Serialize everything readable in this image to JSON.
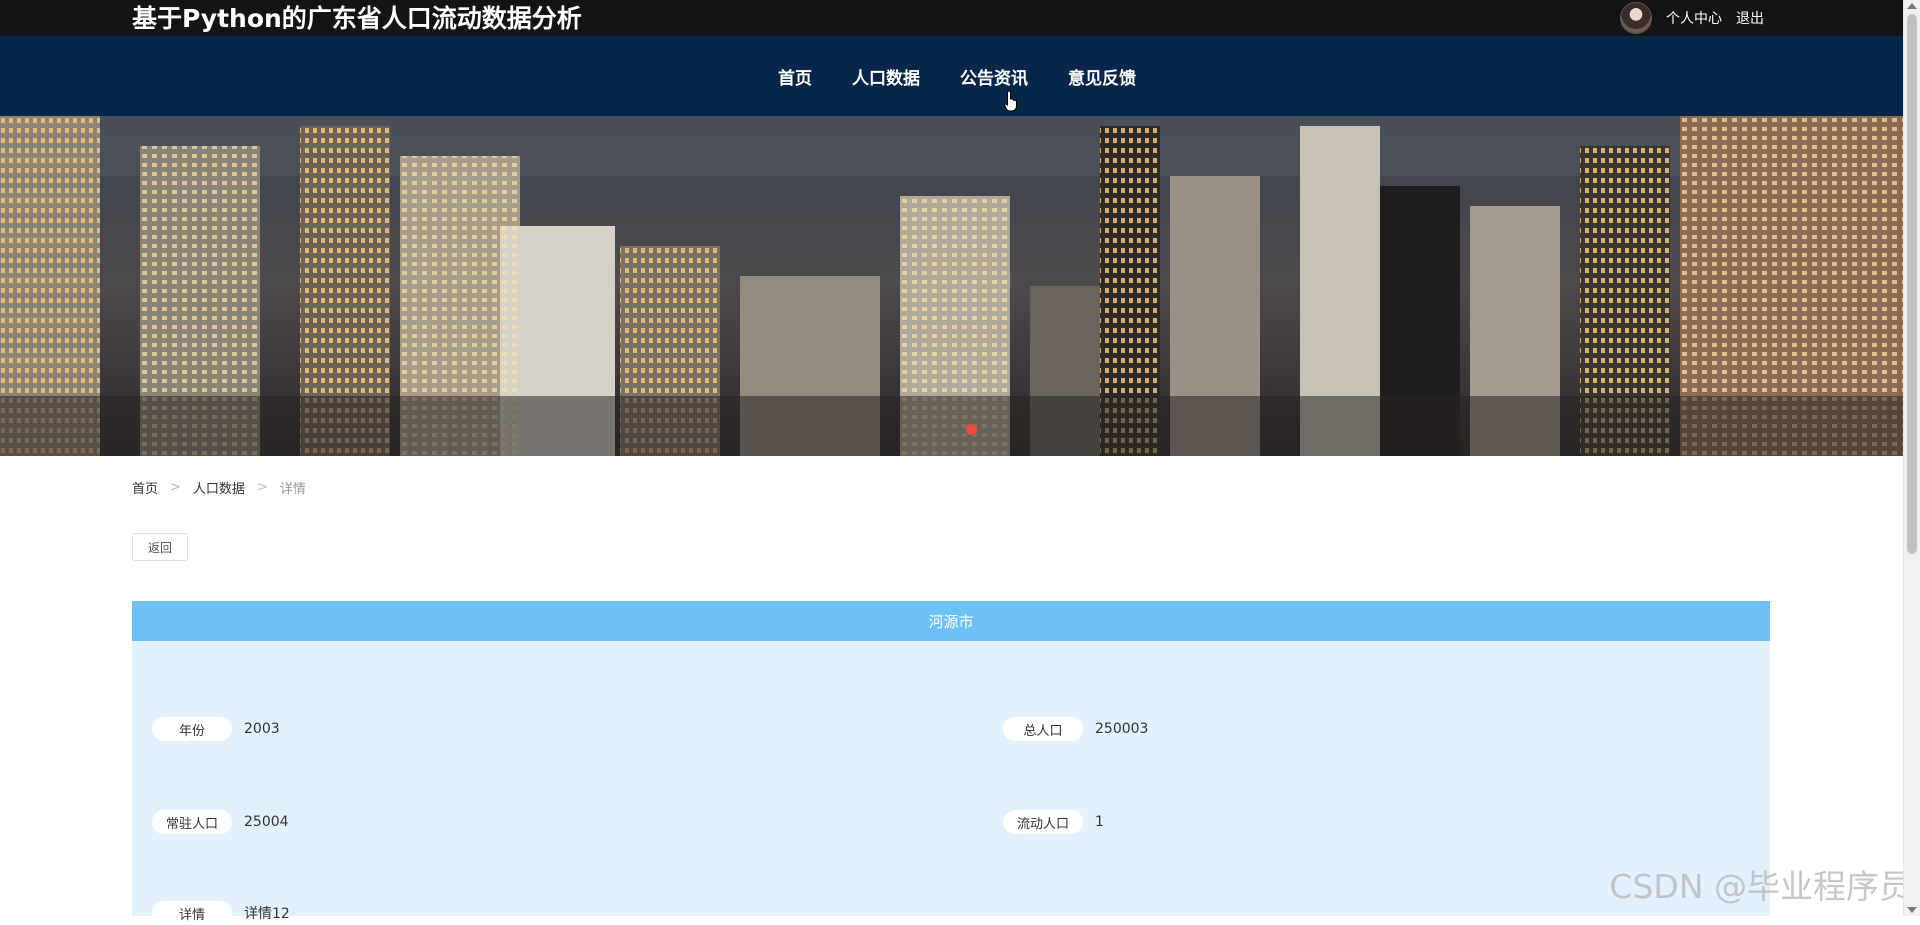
{
  "header": {
    "site_title": "基于Python的广东省人口流动数据分析",
    "user_center": "个人中心",
    "logout": "退出"
  },
  "nav": {
    "items": [
      {
        "label": "首页"
      },
      {
        "label": "人口数据"
      },
      {
        "label": "公告资讯"
      },
      {
        "label": "意见反馈"
      }
    ]
  },
  "breadcrumb": {
    "home": "首页",
    "section": "人口数据",
    "current": "详情",
    "separator": ">"
  },
  "back_button": "返回",
  "detail": {
    "title": "河源市",
    "fields": [
      {
        "label": "年份",
        "value": "2003"
      },
      {
        "label": "总人口",
        "value": "250003"
      },
      {
        "label": "常驻人口",
        "value": "25004"
      },
      {
        "label": "流动人口",
        "value": "1"
      },
      {
        "label": "详情",
        "value": "详情12"
      }
    ]
  },
  "watermark": "CSDN @毕业程序员",
  "colors": {
    "topbar": "#141414",
    "navbar": "#062749",
    "detail_header": "#6ec1f7",
    "detail_bg": "#e1f2fd",
    "carousel_dot": "#e74c3c"
  }
}
